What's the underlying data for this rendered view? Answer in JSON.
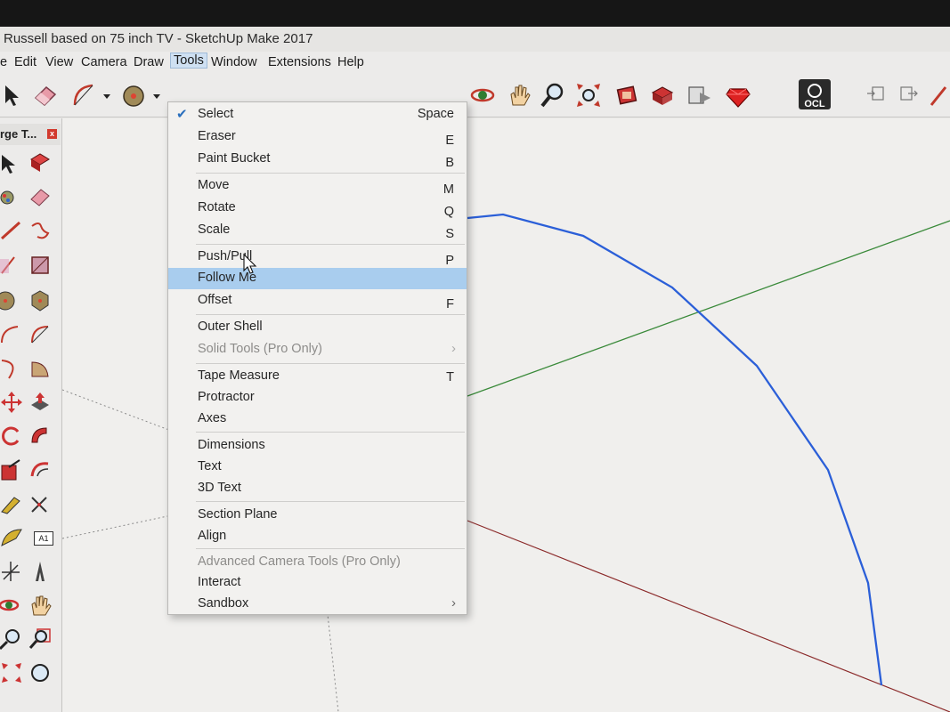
{
  "window": {
    "title": "Russell based on 75 inch TV - SketchUp Make 2017"
  },
  "menubar": {
    "items": [
      {
        "label": "e"
      },
      {
        "label": "Edit"
      },
      {
        "label": "View"
      },
      {
        "label": "Camera"
      },
      {
        "label": "Draw"
      },
      {
        "label": "Tools"
      },
      {
        "label": "Window"
      },
      {
        "label": "Extensions"
      },
      {
        "label": "Help"
      }
    ]
  },
  "toolbar": {
    "ocl_label": "OCL"
  },
  "tray": {
    "title": "rge T...",
    "close_label": "x",
    "text_tool_label": "A1"
  },
  "tools_menu": {
    "groups": [
      [
        {
          "label": "Select",
          "shortcut": "Space",
          "checked": true
        },
        {
          "label": "Eraser",
          "shortcut": "E"
        },
        {
          "label": "Paint Bucket",
          "shortcut": "B"
        }
      ],
      [
        {
          "label": "Move",
          "shortcut": "M"
        },
        {
          "label": "Rotate",
          "shortcut": "Q"
        },
        {
          "label": "Scale",
          "shortcut": "S"
        }
      ],
      [
        {
          "label": "Push/Pull",
          "shortcut": "P"
        },
        {
          "label": "Follow Me",
          "shortcut": "",
          "highlighted": true
        },
        {
          "label": "Offset",
          "shortcut": "F"
        }
      ],
      [
        {
          "label": "Outer Shell",
          "shortcut": ""
        },
        {
          "label": "Solid Tools (Pro Only)",
          "shortcut": "",
          "disabled": true,
          "submenu": true
        }
      ],
      [
        {
          "label": "Tape Measure",
          "shortcut": "T"
        },
        {
          "label": "Protractor",
          "shortcut": ""
        },
        {
          "label": "Axes",
          "shortcut": ""
        }
      ],
      [
        {
          "label": "Dimensions",
          "shortcut": ""
        },
        {
          "label": "Text",
          "shortcut": ""
        },
        {
          "label": "3D Text",
          "shortcut": ""
        }
      ],
      [
        {
          "label": "Section Plane",
          "shortcut": ""
        },
        {
          "label": "Align",
          "shortcut": ""
        }
      ],
      [
        {
          "label": "Advanced Camera Tools (Pro Only)",
          "shortcut": "",
          "disabled": true
        },
        {
          "label": "Interact",
          "shortcut": ""
        },
        {
          "label": "Sandbox",
          "shortcut": "",
          "submenu": true
        }
      ]
    ]
  },
  "icons": {
    "select": "select-arrow-icon",
    "eraser": "eraser-icon",
    "arc": "arc-icon",
    "paint": "paint-bucket-icon",
    "orbit": "orbit-icon",
    "pan": "pan-hand-icon",
    "zoom": "zoom-icon",
    "zoom_extents": "zoom-extents-icon",
    "warehouse": "3d-warehouse-icon",
    "share": "share-model-icon",
    "components": "extension-warehouse-icon",
    "ruby": "ruby-icon",
    "ocl": "ocl-extension-icon",
    "import": "import-icon",
    "export": "export-icon",
    "pencil": "pencil-icon",
    "cursor": "mouse-cursor-icon",
    "checkmark": "checkmark-icon",
    "submenu_arrow": "chevron-right-icon"
  },
  "colors": {
    "menu_highlight": "#a9cdee",
    "check_blue": "#2a6fbd",
    "axis_green": "#3a8a3a",
    "axis_red": "#8b2a2a",
    "curve_blue": "#2b5fd8"
  }
}
